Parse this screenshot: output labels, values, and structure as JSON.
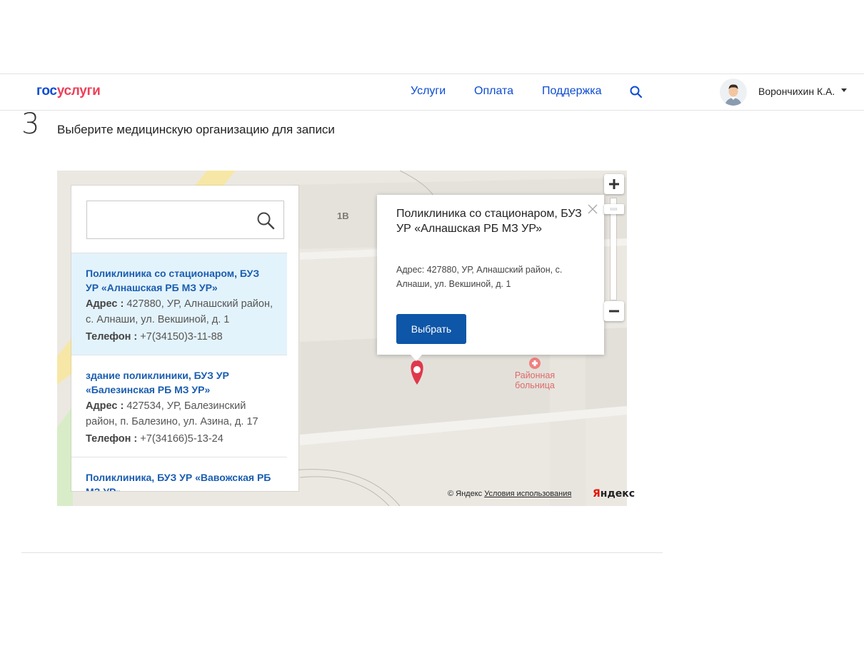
{
  "header": {
    "logo_part1": "гос",
    "logo_part2": "услуги",
    "nav": [
      "Услуги",
      "Оплата",
      "Поддержка"
    ],
    "user_name": "Ворончихин К.А."
  },
  "step": {
    "number": "3",
    "title": "Выберите медицинскую организацию для записи"
  },
  "search": {
    "value": "",
    "placeholder": ""
  },
  "organizations": [
    {
      "name": "Поликлиника со стационаром, БУЗ УР «Алнашская РБ МЗ УР»",
      "address_label": "Адрес :",
      "address": "427880, УР, Алнашский район, с. Алнаши, ул. Векшиной, д. 1",
      "phone_label": "Телефон :",
      "phone": "+7(34150)3-11-88"
    },
    {
      "name": "здание поликлиники, БУЗ УР «Балезинская РБ МЗ УР»",
      "address_label": "Адрес :",
      "address": "427534, УР, Балезинский район, п. Балезино, ул. Азина, д. 17",
      "phone_label": "Телефон :",
      "phone": "+7(34166)5-13-24"
    },
    {
      "name": "Поликлиника, БУЗ УР «Вавожская РБ МЗ УР»",
      "address_label": "",
      "address": "",
      "phone_label": "",
      "phone": ""
    }
  ],
  "balloon": {
    "title": "Поликлиника со стационаром, БУЗ УР «Алнашская РБ МЗ УР»",
    "address": "Адрес: 427880, УР, Алнашский район, с. Алнаши, ул. Векшиной, д. 1",
    "button": "Выбрать"
  },
  "map": {
    "building_label": "1В",
    "poi_label_line1": "Районная",
    "poi_label_line2": "больница",
    "copyright": "© Яндекс",
    "terms": "Условия использования",
    "logo_y": "Я",
    "logo_rest": "ндекс"
  },
  "colors": {
    "brand_blue": "#0d4cd3",
    "brand_red": "#ee3f58",
    "active_item_bg": "#e3f3fb",
    "button_blue": "#0d56a8",
    "marker_red": "#e0384b"
  }
}
